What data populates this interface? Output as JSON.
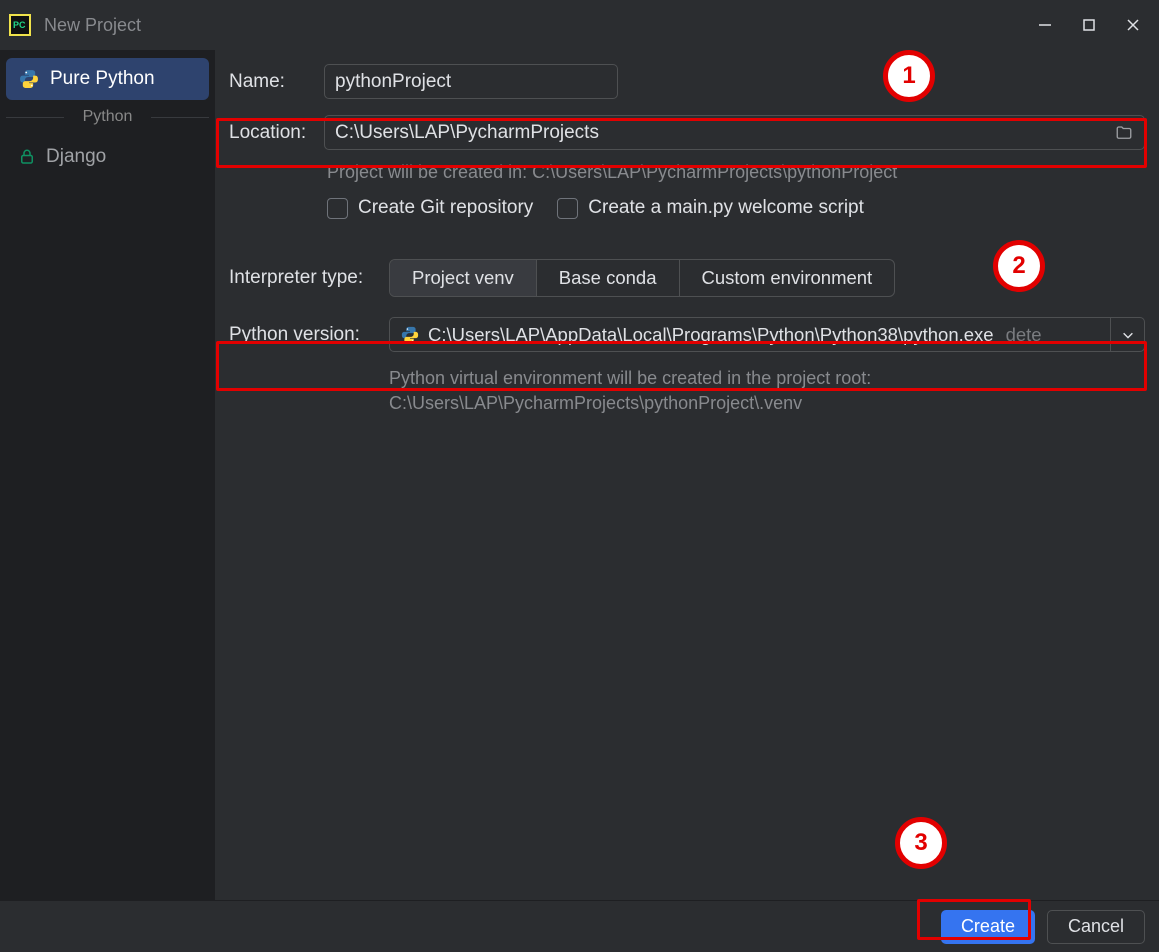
{
  "titlebar": {
    "title": "New Project"
  },
  "sidebar": {
    "header": "Python",
    "items": [
      {
        "label": "Pure Python",
        "selected": true,
        "icon": "python-icon"
      },
      {
        "label": "Django",
        "selected": false,
        "icon": "lock-icon"
      }
    ]
  },
  "form": {
    "name_label": "Name:",
    "name_value": "pythonProject",
    "location_label": "Location:",
    "location_value": "C:\\Users\\LAP\\PycharmProjects",
    "location_hint": "Project will be created in: C:\\Users\\LAP\\PycharmProjects\\pythonProject",
    "checks": [
      {
        "label": "Create Git repository",
        "checked": false
      },
      {
        "label": "Create a main.py welcome script",
        "checked": false
      }
    ],
    "interpreter_label": "Interpreter type:",
    "interpreter_options": [
      {
        "label": "Project venv",
        "selected": true
      },
      {
        "label": "Base conda",
        "selected": false
      },
      {
        "label": "Custom environment",
        "selected": false
      }
    ],
    "pyver_label": "Python version:",
    "pyver_value": "C:\\Users\\LAP\\AppData\\Local\\Programs\\Python\\Python38\\python.exe",
    "pyver_suffix": "dete",
    "venv_hint_line1": "Python virtual environment will be created in the project root:",
    "venv_hint_line2": "C:\\Users\\LAP\\PycharmProjects\\pythonProject\\.venv"
  },
  "footer": {
    "create": "Create",
    "cancel": "Cancel"
  },
  "annotations": {
    "n1": "1",
    "n2": "2",
    "n3": "3"
  }
}
